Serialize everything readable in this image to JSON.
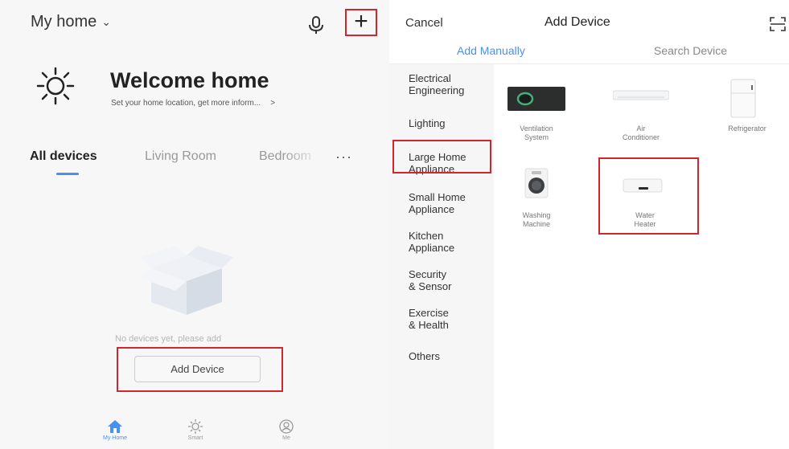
{
  "left": {
    "home_title": "My home",
    "add_symbol": "+",
    "welcome_title": "Welcome home",
    "welcome_sub": "Set your home location, get more inform...",
    "welcome_arrow": ">",
    "tabs": [
      {
        "label": "All devices",
        "active": true
      },
      {
        "label": "Living Room",
        "active": false
      },
      {
        "label": "Bedroom",
        "active": false
      }
    ],
    "more": "···",
    "empty_text": "No devices yet, please add",
    "add_button": "Add Device",
    "nav": [
      {
        "label": "My Home",
        "icon": "home-icon"
      },
      {
        "label": "Smart",
        "icon": "smart-sun-icon"
      },
      {
        "label": "Me",
        "icon": "profile-icon"
      }
    ]
  },
  "right": {
    "cancel": "Cancel",
    "title": "Add Device",
    "tabs": [
      "Add Manually",
      "Search Device"
    ],
    "categories": [
      "Electrical\nEngineering",
      "Lighting",
      "Large Home\nAppliance",
      "Small Home\nAppliance",
      "Kitchen\nAppliance",
      "Security\n& Sensor",
      "Exercise\n& Health",
      "Others"
    ],
    "selected_category": "Large Home\nAppliance",
    "devices": [
      {
        "label": "Ventilation\nSystem",
        "icon": "ventilation-icon"
      },
      {
        "label": "Air\nConditioner",
        "icon": "air-conditioner-icon"
      },
      {
        "label": "Refrigerator",
        "icon": "refrigerator-icon"
      },
      {
        "label": "Washing\nMachine",
        "icon": "washing-machine-icon"
      },
      {
        "label": "Water\nHeater",
        "icon": "water-heater-icon"
      }
    ]
  },
  "colors": {
    "accent": "#4b8ff0",
    "highlight_frame": "#d0262d",
    "category_indicator": "#f5a623"
  }
}
